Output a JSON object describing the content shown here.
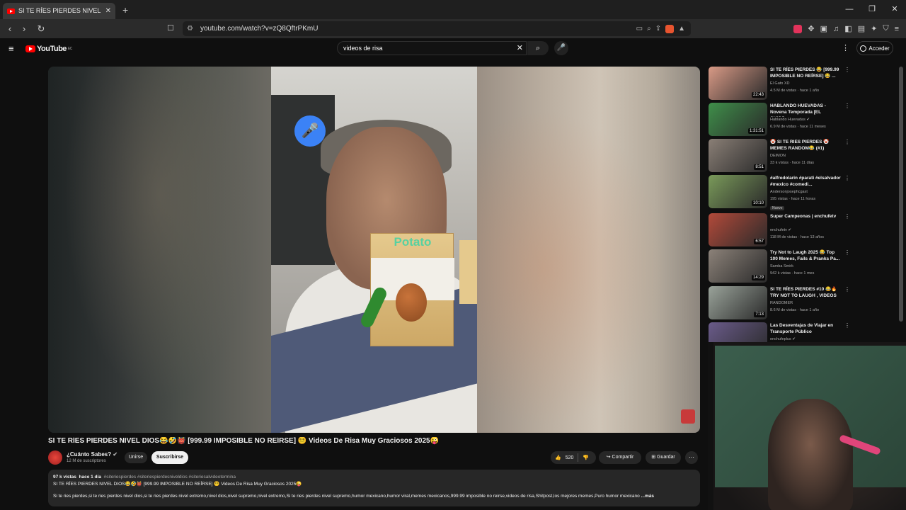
{
  "browser": {
    "tab_title": "SI TE RÍES PIERDES NIVEL DIOS😂🎁",
    "url": "youtube.com/watch?v=zQ8QftrPKmU"
  },
  "header": {
    "logo_text": "YouTube",
    "logo_region": "EC",
    "search_value": "videos de risa",
    "login_label": "Acceder"
  },
  "video": {
    "title": "SI TE RÍES PIERDES NIVEL DIOS😂🤣👹 [999.99 IMPOSIBLE NO REÍRSE] 😵‍💫 Videos De Risa Muy Graciosos 2025😜",
    "overlay_label": "Potato",
    "channel_name": "¿Cuánto Sabes?",
    "subscribers": "12 M de suscriptores",
    "join_label": "Unirse",
    "subscribe_label": "Suscribirse",
    "likes": "520",
    "share_label": "Compartir",
    "save_label": "Guardar"
  },
  "description": {
    "views": "97 k vistas",
    "age": "hace 1 día",
    "tags": "#siteriespierdes #siteriespierdesniveldios #siteriesalvideotermina",
    "line2": "SI TE RÍES PIERDES NIVEL DIOS😂🤣👹 [999.99 IMPOSIBLE NO REÍRSE] 😵‍💫 Videos De Risa Muy Graciosos 2025😜",
    "line3": "Si te ries pierdes,si te ries pierdes nivel dios,si te ries pierdes nivel extremo,nivel dios,nivel supremo,nivel extremo,Si te ries pierdes nivel supremo,humor mexicano,humor viral,memes mexicanos,999.99 imposible no reirse,videos de risa,Shitpost,los mejores memes,Puro humor mexicano",
    "more": "...más"
  },
  "sidebar": [
    {
      "title": "SI TE RÍES PIERDES 😂 [999.99 IMPOSIBLE NO REÍRSE] 😂 ...",
      "channel": "El Gato XD",
      "meta": "4.5 M de vistas · hace 1 año",
      "duration": "22:43",
      "thumb": "#d99a86"
    },
    {
      "title": "HABLANDO HUEVADAS - Novena Temporada [EL CHICO...",
      "channel": "Hablando Huevadas ✔",
      "meta": "6.9 M de vistas · hace 11 meses",
      "duration": "1:31:51",
      "thumb": "#3f8f4a"
    },
    {
      "title": "🤡 SI TE RIES PIERDES 🤡 MEMES RANDOM😂 (#1)",
      "channel": "DEIMON",
      "meta": "33 k vistas · hace 11 días",
      "duration": "8:51",
      "thumb": "#8a7f76"
    },
    {
      "title": "#alfredolarin #parati #elsalvador #mexico #comedi...",
      "channel": "Andersonjosephcgaxt",
      "meta": "195 vistas · hace 11 horas",
      "duration": "10:10",
      "thumb": "#7a9a5a",
      "badge": "Nuevo"
    },
    {
      "title": "Super Campeonas | enchufetv",
      "channel": "enchufetv ✔",
      "meta": "118 M de vistas · hace 13 años",
      "duration": "6:57",
      "thumb": "#b34a3a"
    },
    {
      "title": "Try Not to Laugh 2025 😂 Top 100 Memes, Fails & Pranks Pa...",
      "channel": "Samba Smirk",
      "meta": "942 k vistas · hace 1 mes",
      "duration": "14:29",
      "thumb": "#8c8279"
    },
    {
      "title": "SI TE RÍES PIERDES #10 😂🔥 TRY NOT TO LAUGH , VIDEOS ...",
      "channel": "RANDOMER",
      "meta": "8.6 M de vistas · hace 1 año",
      "duration": "7:13",
      "thumb": "#9aa39a"
    },
    {
      "title": "Las Desventajas de Viajar en Transporte Público",
      "channel": "enchufeplus ✔",
      "meta": "",
      "duration": "",
      "thumb": "#6a5b8a"
    }
  ],
  "colors": {
    "accent": "#ff0000",
    "bg": "#0f0f0f",
    "chip": "#272727"
  }
}
